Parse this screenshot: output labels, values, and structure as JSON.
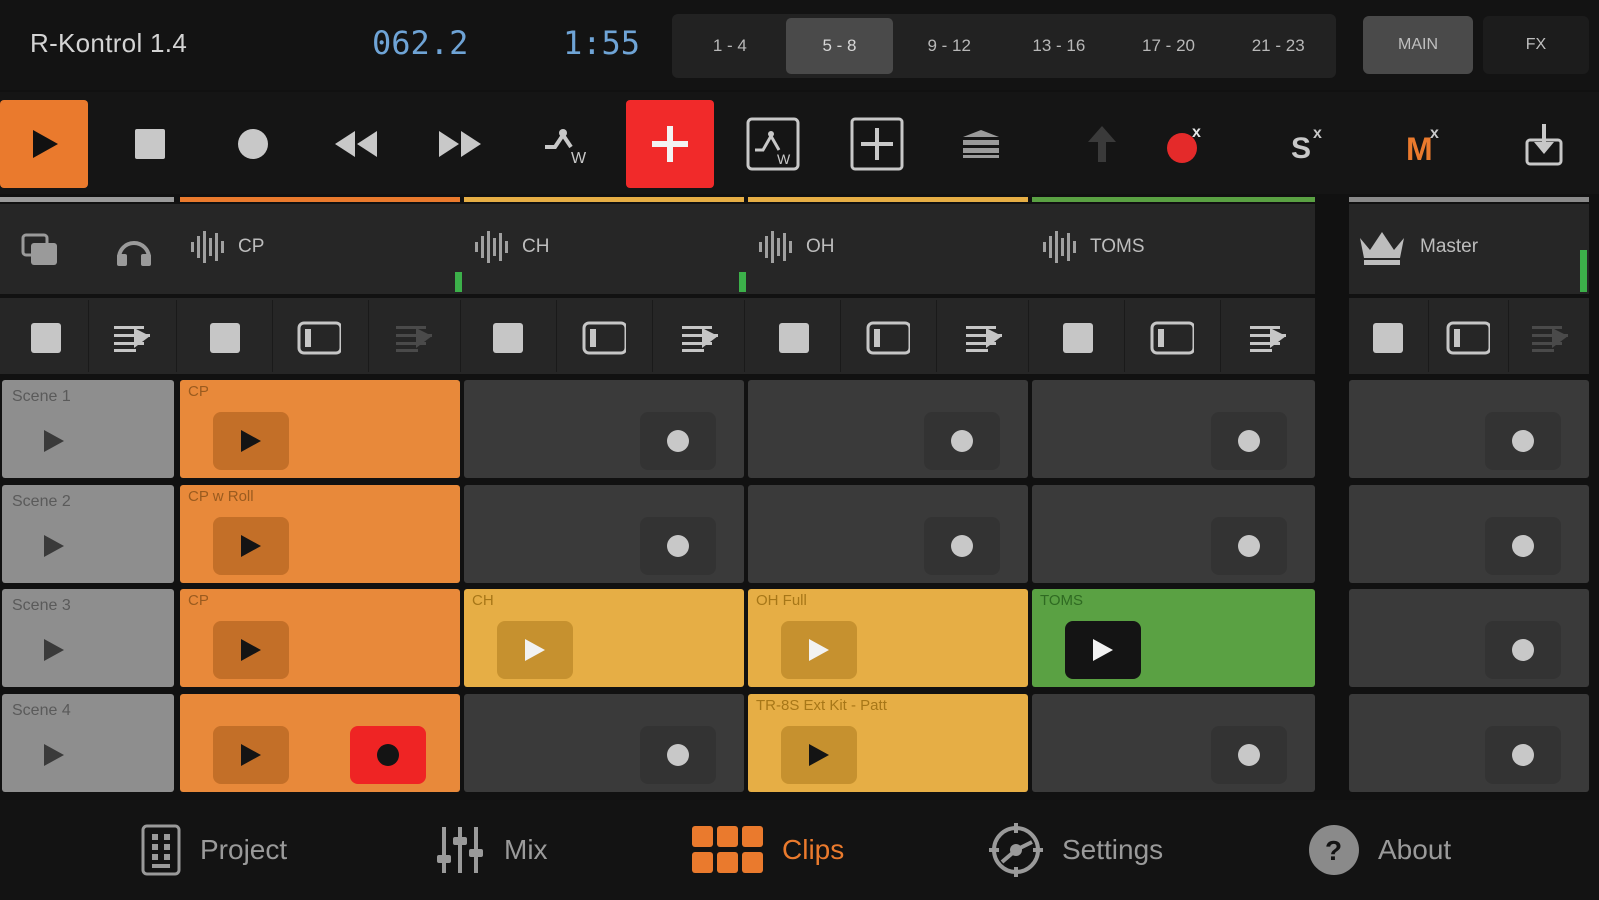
{
  "header": {
    "app_title": "R-Kontrol 1.4",
    "position": "062.2",
    "time": "1:55",
    "banks": [
      "1 - 4",
      "5 - 8",
      "9 - 12",
      "13 - 16",
      "17 - 20",
      "21 - 23"
    ],
    "active_bank": "5 - 8",
    "main_label": "MAIN",
    "fx_label": "FX"
  },
  "toolbar": {
    "icons": [
      "play-icon",
      "stop-icon",
      "record-icon",
      "rewind-icon",
      "fast-forward-icon",
      "write-automation-icon",
      "add-icon",
      "automation-lane-icon",
      "add-box-icon",
      "stack-icon",
      "up-arrow-icon",
      "clear-record-icon",
      "clear-solo-icon",
      "clear-mute-icon",
      "export-icon"
    ],
    "colors": {
      "play": "#ea7a2d",
      "add": "#f12a2a",
      "record_dot": "#e42a2a",
      "mute": "#ea7a2d"
    },
    "clear_letter": "x",
    "solo_letter": "S",
    "mute_letter": "M",
    "write_letter": "W"
  },
  "tracks": [
    {
      "name": "CP",
      "color": "#ea7a2d"
    },
    {
      "name": "CH",
      "color": "#e6ae45"
    },
    {
      "name": "OH",
      "color": "#e6ae45"
    },
    {
      "name": "TOMS",
      "color": "#5aa143"
    }
  ],
  "master": {
    "name": "Master",
    "color": "#6a6a6a"
  },
  "scenes": [
    {
      "label": "Scene 1"
    },
    {
      "label": "Scene 2"
    },
    {
      "label": "Scene 3"
    },
    {
      "label": "Scene 4"
    }
  ],
  "clips": {
    "r0": [
      "CP",
      "",
      "",
      ""
    ],
    "r1": [
      "CP w Roll",
      "",
      "",
      ""
    ],
    "r2": [
      "CP",
      "CH",
      "OH Full",
      "TOMS"
    ],
    "r3": [
      "",
      "",
      "TR-8S Ext Kit - Patt",
      ""
    ]
  },
  "nav": {
    "items": [
      "Project",
      "Mix",
      "Clips",
      "Settings",
      "About"
    ],
    "active": "Clips"
  }
}
